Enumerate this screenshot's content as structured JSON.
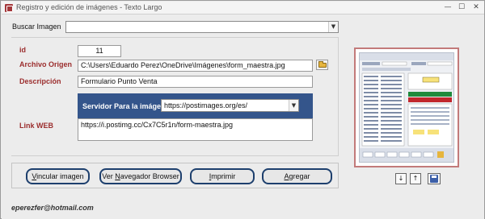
{
  "window": {
    "title": "Registro y edición de imágenes - Texto Largo",
    "minimize": "—",
    "maximize": "☐",
    "close": "✕"
  },
  "search": {
    "label": "Buscar Imagen",
    "value": ""
  },
  "form": {
    "id_label": "id",
    "id_value": "11",
    "archivo_label": "Archivo Origen",
    "archivo_value": "C:\\Users\\Eduardo Perez\\OneDrive\\Imágenes\\form_maestra.jpg",
    "descripcion_label": "Descripción",
    "descripcion_value": "Formulario Punto Venta",
    "servidor_label": "Servidor Para la imágen",
    "servidor_value": "https://postimages.org/es/",
    "link_label": "Link WEB",
    "link_value": "https://i.postimg.cc/Cx7C5r1n/form-maestra.jpg"
  },
  "buttons": {
    "vincular_prefix": "",
    "vincular_key": "V",
    "vincular_rest": "incular imagen",
    "ver_prefix": "Ver ",
    "ver_key": "N",
    "ver_rest": "avegador  Browser",
    "imprimir_prefix": "",
    "imprimir_key": "I",
    "imprimir_rest": "mprimir",
    "agregar_prefix": "",
    "agregar_key": "A",
    "agregar_rest": "gregar"
  },
  "footer": {
    "email": "eperezfer@hotmail.com"
  },
  "nav": {
    "down": "↓",
    "up": "↑"
  },
  "colors": {
    "label_red": "#9b2d2d",
    "panel_blue": "#34558b",
    "button_border": "#1d3f6d",
    "image_frame": "#c27a7a"
  }
}
